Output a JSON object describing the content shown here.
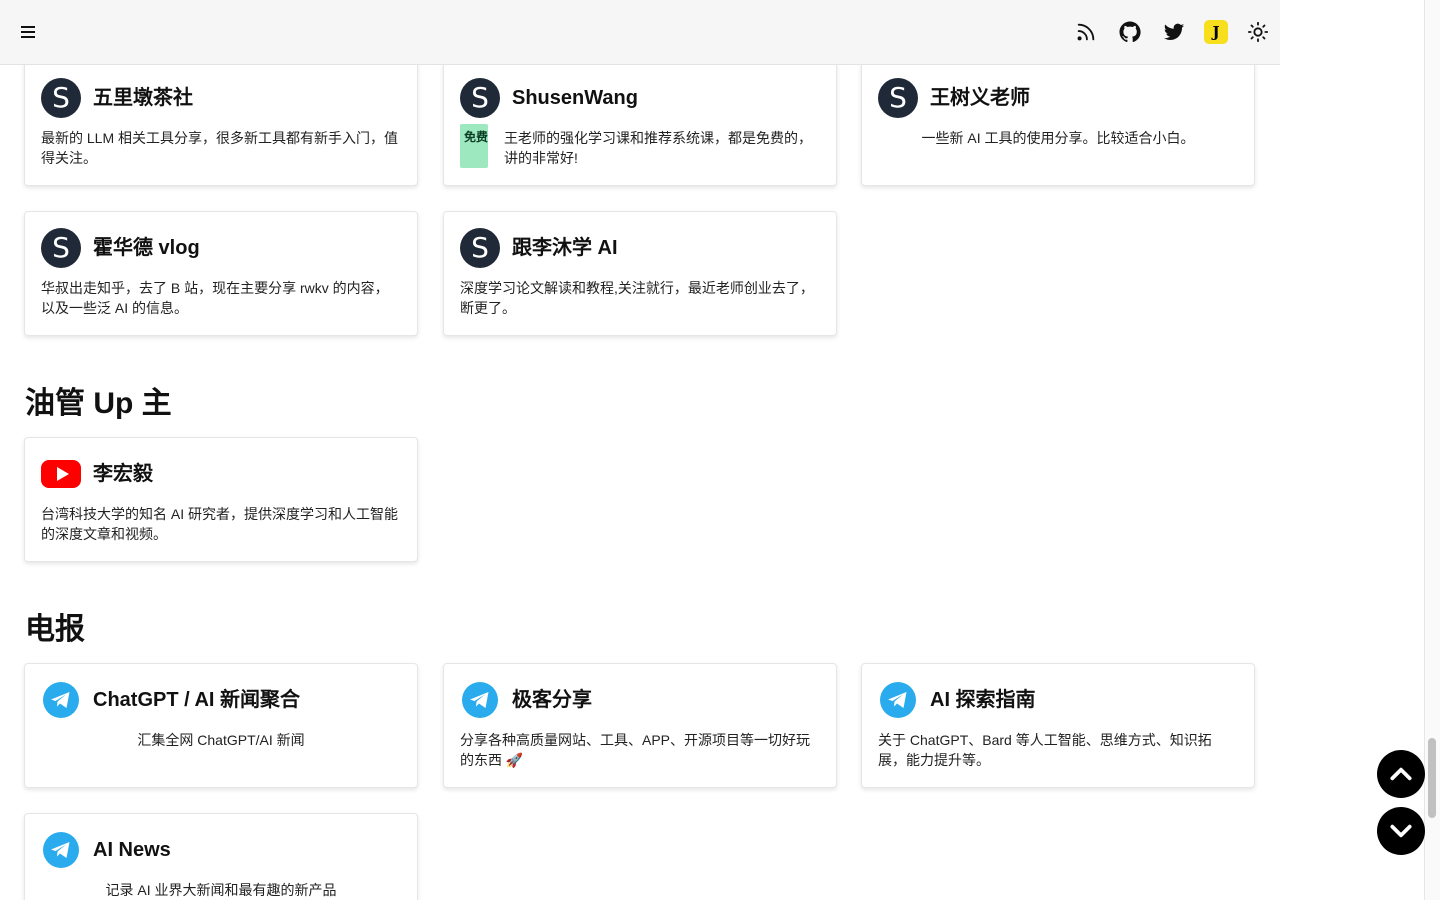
{
  "sections": {
    "youtube_title": "油管 Up 主",
    "telegram_title": "电报"
  },
  "bilibili_cards": [
    {
      "title": "五里墩茶社",
      "desc": "最新的 LLM 相关工具分享，很多新工具都有新手入门，值得关注。"
    },
    {
      "title": "ShusenWang",
      "badge": "免费",
      "desc": "王老师的强化学习课和推荐系统课，都是免费的，讲的非常好!"
    },
    {
      "title": "王树义老师",
      "desc": "一些新 AI 工具的使用分享。比较适合小白。"
    },
    {
      "title": "霍华德 vlog",
      "desc": "华叔出走知乎，去了 B 站，现在主要分享 rwkv 的内容，以及一些泛 AI 的信息。"
    },
    {
      "title": "跟李沐学 AI",
      "desc": "深度学习论文解读和教程,关注就行，最近老师创业去了，断更了。"
    }
  ],
  "avatar_letter": "S",
  "youtube_cards": [
    {
      "title": "李宏毅",
      "desc": "台湾科技大学的知名 AI 研究者，提供深度学习和人工智能的深度文章和视频。"
    }
  ],
  "telegram_cards": [
    {
      "title": "ChatGPT / AI 新闻聚合",
      "desc": "汇集全网 ChatGPT/AI 新闻"
    },
    {
      "title": "极客分享",
      "desc": "分享各种高质量网站、工具、APP、开源项目等一切好玩的东西 🚀"
    },
    {
      "title": "AI 探索指南",
      "desc": "关于 ChatGPT、Bard 等人工智能、思维方式、知识拓展，能力提升等。"
    },
    {
      "title": "AI News",
      "desc": "记录 AI 业界大新闻和最有趣的新产品"
    }
  ],
  "header": {
    "juejin_letter": "J"
  },
  "colors": {
    "badge_bg": "#9ee8c0",
    "youtube_red": "#ff0000",
    "telegram_blue": "#2aabee",
    "juejin_yellow": "#f7df1e"
  }
}
